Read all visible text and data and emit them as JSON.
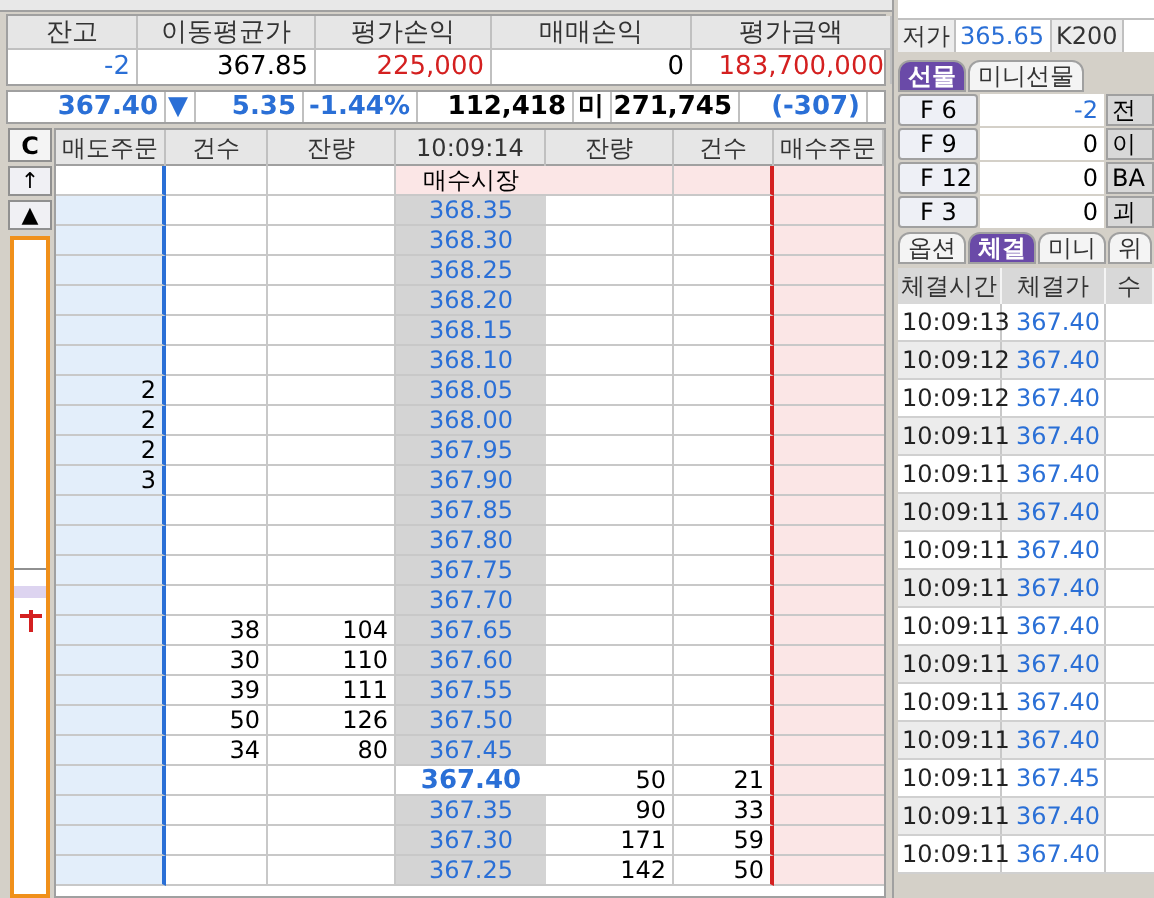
{
  "account": {
    "columns": [
      "잔고",
      "이동평균가",
      "평가손익",
      "매매손익",
      "평가금액"
    ],
    "values": [
      {
        "text": "-2",
        "color": "#2a6fd6"
      },
      {
        "text": "367.85",
        "color": "#000000"
      },
      {
        "text": "225,000",
        "color": "#d42020"
      },
      {
        "text": "0",
        "color": "#000000"
      },
      {
        "text": "183,700,000",
        "color": "#d42020"
      }
    ]
  },
  "quote": [
    {
      "text": "367.40",
      "color": "#2a6fd6"
    },
    {
      "text": "▼",
      "color": "#2a6fd6"
    },
    {
      "text": "5.35",
      "color": "#2a6fd6"
    },
    {
      "text": "-1.44%",
      "color": "#2a6fd6"
    },
    {
      "text": "112,418",
      "color": "#000000"
    },
    {
      "text": "미",
      "color": "#000000"
    },
    {
      "text": "271,745",
      "color": "#000000"
    },
    {
      "text": "(-307)",
      "color": "#2a6fd6"
    }
  ],
  "orderbook": {
    "clear_button": "C",
    "columns": [
      "매도주문",
      "건수",
      "잔량",
      "10:09:14",
      "잔량",
      "건수",
      "매수주문"
    ],
    "side_buttons": [
      "↑",
      "▲"
    ],
    "market_label": "매수시장",
    "rows": [
      {
        "ask_order": "",
        "ask_count": "",
        "ask_qty": "",
        "price": "368.35",
        "bid_qty": "",
        "bid_count": "",
        "current": false
      },
      {
        "ask_order": "",
        "ask_count": "",
        "ask_qty": "",
        "price": "368.30",
        "bid_qty": "",
        "bid_count": "",
        "current": false
      },
      {
        "ask_order": "",
        "ask_count": "",
        "ask_qty": "",
        "price": "368.25",
        "bid_qty": "",
        "bid_count": "",
        "current": false
      },
      {
        "ask_order": "",
        "ask_count": "",
        "ask_qty": "",
        "price": "368.20",
        "bid_qty": "",
        "bid_count": "",
        "current": false
      },
      {
        "ask_order": "",
        "ask_count": "",
        "ask_qty": "",
        "price": "368.15",
        "bid_qty": "",
        "bid_count": "",
        "current": false
      },
      {
        "ask_order": "",
        "ask_count": "",
        "ask_qty": "",
        "price": "368.10",
        "bid_qty": "",
        "bid_count": "",
        "current": false
      },
      {
        "ask_order": "2",
        "ask_count": "",
        "ask_qty": "",
        "price": "368.05",
        "bid_qty": "",
        "bid_count": "",
        "current": false
      },
      {
        "ask_order": "2",
        "ask_count": "",
        "ask_qty": "",
        "price": "368.00",
        "bid_qty": "",
        "bid_count": "",
        "current": false
      },
      {
        "ask_order": "2",
        "ask_count": "",
        "ask_qty": "",
        "price": "367.95",
        "bid_qty": "",
        "bid_count": "",
        "current": false
      },
      {
        "ask_order": "3",
        "ask_count": "",
        "ask_qty": "",
        "price": "367.90",
        "bid_qty": "",
        "bid_count": "",
        "current": false
      },
      {
        "ask_order": "",
        "ask_count": "",
        "ask_qty": "",
        "price": "367.85",
        "bid_qty": "",
        "bid_count": "",
        "current": false
      },
      {
        "ask_order": "",
        "ask_count": "",
        "ask_qty": "",
        "price": "367.80",
        "bid_qty": "",
        "bid_count": "",
        "current": false
      },
      {
        "ask_order": "",
        "ask_count": "",
        "ask_qty": "",
        "price": "367.75",
        "bid_qty": "",
        "bid_count": "",
        "current": false
      },
      {
        "ask_order": "",
        "ask_count": "",
        "ask_qty": "",
        "price": "367.70",
        "bid_qty": "",
        "bid_count": "",
        "current": false
      },
      {
        "ask_order": "",
        "ask_count": "38",
        "ask_qty": "104",
        "price": "367.65",
        "bid_qty": "",
        "bid_count": "",
        "current": false
      },
      {
        "ask_order": "",
        "ask_count": "30",
        "ask_qty": "110",
        "price": "367.60",
        "bid_qty": "",
        "bid_count": "",
        "current": false
      },
      {
        "ask_order": "",
        "ask_count": "39",
        "ask_qty": "111",
        "price": "367.55",
        "bid_qty": "",
        "bid_count": "",
        "current": false
      },
      {
        "ask_order": "",
        "ask_count": "50",
        "ask_qty": "126",
        "price": "367.50",
        "bid_qty": "",
        "bid_count": "",
        "current": false
      },
      {
        "ask_order": "",
        "ask_count": "34",
        "ask_qty": "80",
        "price": "367.45",
        "bid_qty": "",
        "bid_count": "",
        "current": false
      },
      {
        "ask_order": "",
        "ask_count": "",
        "ask_qty": "",
        "price": "367.40",
        "bid_qty": "50",
        "bid_count": "21",
        "current": true
      },
      {
        "ask_order": "",
        "ask_count": "",
        "ask_qty": "",
        "price": "367.35",
        "bid_qty": "90",
        "bid_count": "33",
        "current": false
      },
      {
        "ask_order": "",
        "ask_count": "",
        "ask_qty": "",
        "price": "367.30",
        "bid_qty": "171",
        "bid_count": "59",
        "current": false
      },
      {
        "ask_order": "",
        "ask_count": "",
        "ask_qty": "",
        "price": "367.25",
        "bid_qty": "142",
        "bid_count": "50",
        "current": false
      }
    ]
  },
  "summary": [
    {
      "label": "저가",
      "value": "365.65"
    },
    {
      "label": "K200"
    }
  ],
  "futures_tabs": [
    {
      "label": "선물",
      "selected": true
    },
    {
      "label": "미니선물",
      "selected": false
    }
  ],
  "futures": [
    {
      "month": "F 6",
      "qty": "-2",
      "color": "#2a6fd6",
      "side": "전"
    },
    {
      "month": "F 9",
      "qty": "0",
      "color": "#000000",
      "side": "이"
    },
    {
      "month": "F 12",
      "qty": "0",
      "color": "#000000",
      "side": "BA"
    },
    {
      "month": "F 3",
      "qty": "0",
      "color": "#000000",
      "side": "괴"
    }
  ],
  "trade_tabs": [
    {
      "label": "옵션",
      "selected": false
    },
    {
      "label": "체결",
      "selected": true
    },
    {
      "label": "미니",
      "selected": false
    },
    {
      "label": "위",
      "selected": false
    }
  ],
  "trades": {
    "columns": [
      "체결시간",
      "체결가",
      "수"
    ],
    "rows": [
      [
        "10:09:13",
        "367.40"
      ],
      [
        "10:09:12",
        "367.40"
      ],
      [
        "10:09:12",
        "367.40"
      ],
      [
        "10:09:11",
        "367.40"
      ],
      [
        "10:09:11",
        "367.40"
      ],
      [
        "10:09:11",
        "367.40"
      ],
      [
        "10:09:11",
        "367.40"
      ],
      [
        "10:09:11",
        "367.40"
      ],
      [
        "10:09:11",
        "367.40"
      ],
      [
        "10:09:11",
        "367.40"
      ],
      [
        "10:09:11",
        "367.40"
      ],
      [
        "10:09:11",
        "367.40"
      ],
      [
        "10:09:11",
        "367.45"
      ],
      [
        "10:09:11",
        "367.40"
      ],
      [
        "10:09:11",
        "367.40"
      ]
    ]
  }
}
